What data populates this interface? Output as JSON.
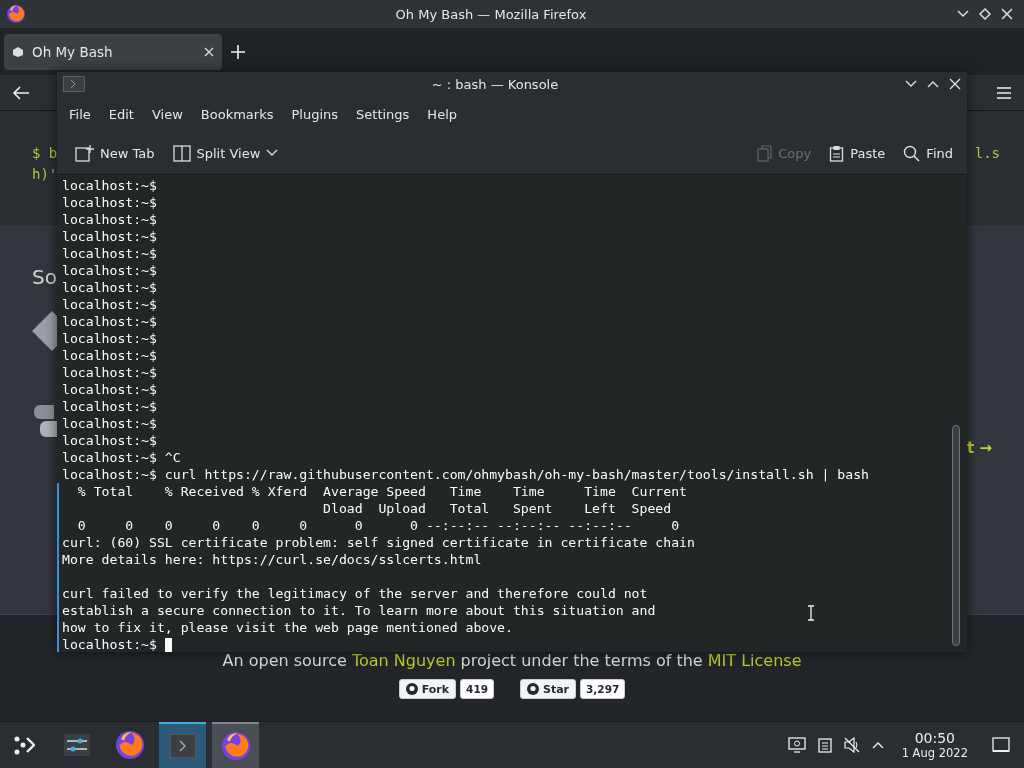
{
  "firefox_window": {
    "title": "Oh My Bash — Mozilla Firefox",
    "tabs": [
      {
        "label": "Oh My Bash",
        "selected": true
      }
    ],
    "page": {
      "code_fragments": [
        "$ b",
        "l.s",
        "h)'"
      ],
      "heading_fragment": "So",
      "link_fragment": "t →",
      "footer": [
        {
          "kind": "plain",
          "text": "An open source "
        },
        {
          "kind": "link",
          "text": "Toan Nguyen"
        },
        {
          "kind": "plain",
          "text": " project under the terms of the "
        },
        {
          "kind": "link",
          "text": "MIT License"
        }
      ],
      "badges": [
        {
          "label": "Fork",
          "count": "419"
        },
        {
          "label": "Star",
          "count": "3,297"
        }
      ]
    }
  },
  "konsole_window": {
    "title": "~ : bash — Konsole",
    "menu": [
      "File",
      "Edit",
      "View",
      "Bookmarks",
      "Plugins",
      "Settings",
      "Help"
    ],
    "toolbar": [
      {
        "kind": "new_tab",
        "label": "New Tab",
        "disabled": false
      },
      {
        "kind": "split_view",
        "label": "Split View",
        "disabled": false
      },
      {
        "kind": "copy",
        "label": "Copy",
        "disabled": true
      },
      {
        "kind": "paste",
        "label": "Paste",
        "disabled": false
      },
      {
        "kind": "find",
        "label": "Find",
        "disabled": false
      }
    ],
    "lines": [
      {
        "kind": "text",
        "text": "localhost:~$",
        "in_block": false,
        "cursor": false
      },
      {
        "kind": "text",
        "text": "localhost:~$",
        "in_block": false,
        "cursor": false
      },
      {
        "kind": "text",
        "text": "localhost:~$",
        "in_block": false,
        "cursor": false
      },
      {
        "kind": "text",
        "text": "localhost:~$",
        "in_block": false,
        "cursor": false
      },
      {
        "kind": "text",
        "text": "localhost:~$",
        "in_block": false,
        "cursor": false
      },
      {
        "kind": "text",
        "text": "localhost:~$",
        "in_block": false,
        "cursor": false
      },
      {
        "kind": "text",
        "text": "localhost:~$",
        "in_block": false,
        "cursor": false
      },
      {
        "kind": "text",
        "text": "localhost:~$",
        "in_block": false,
        "cursor": false
      },
      {
        "kind": "text",
        "text": "localhost:~$",
        "in_block": false,
        "cursor": false
      },
      {
        "kind": "text",
        "text": "localhost:~$",
        "in_block": false,
        "cursor": false
      },
      {
        "kind": "text",
        "text": "localhost:~$",
        "in_block": false,
        "cursor": false
      },
      {
        "kind": "text",
        "text": "localhost:~$",
        "in_block": false,
        "cursor": false
      },
      {
        "kind": "text",
        "text": "localhost:~$",
        "in_block": false,
        "cursor": false
      },
      {
        "kind": "text",
        "text": "localhost:~$",
        "in_block": false,
        "cursor": false
      },
      {
        "kind": "text",
        "text": "localhost:~$",
        "in_block": false,
        "cursor": false
      },
      {
        "kind": "text",
        "text": "localhost:~$",
        "in_block": false,
        "cursor": false
      },
      {
        "kind": "text",
        "text": "localhost:~$ ^C",
        "in_block": false,
        "cursor": false
      },
      {
        "kind": "text",
        "text": "localhost:~$ curl https://raw.githubusercontent.com/ohmybash/oh-my-bash/master/tools/install.sh | bash",
        "in_block": false,
        "cursor": false
      },
      {
        "kind": "text",
        "text": "  % Total    % Received % Xferd  Average Speed   Time    Time     Time  Current",
        "in_block": true,
        "cursor": false
      },
      {
        "kind": "text",
        "text": "                                 Dload  Upload   Total   Spent    Left  Speed",
        "in_block": true,
        "cursor": false
      },
      {
        "kind": "text",
        "text": "  0     0    0     0    0     0      0      0 --:--:-- --:--:-- --:--:--     0",
        "in_block": true,
        "cursor": false
      },
      {
        "kind": "text",
        "text": "curl: (60) SSL certificate problem: self signed certificate in certificate chain",
        "in_block": true,
        "cursor": false
      },
      {
        "kind": "text",
        "text": "More details here: https://curl.se/docs/sslcerts.html",
        "in_block": true,
        "cursor": false
      },
      {
        "kind": "blank",
        "in_block": true,
        "cursor": false
      },
      {
        "kind": "text",
        "text": "curl failed to verify the legitimacy of the server and therefore could not",
        "in_block": true,
        "cursor": false
      },
      {
        "kind": "text",
        "text": "establish a secure connection to it. To learn more about this situation and",
        "in_block": true,
        "cursor": false
      },
      {
        "kind": "text",
        "text": "how to fix it, please visit the web page mentioned above.",
        "in_block": true,
        "cursor": false
      },
      {
        "kind": "text",
        "text": "localhost:~$",
        "in_block": true,
        "cursor": true
      }
    ]
  },
  "taskbar": {
    "tasks": [
      {
        "kind": "launcher",
        "active": false,
        "open": false
      },
      {
        "kind": "settings",
        "active": false,
        "open": false
      },
      {
        "kind": "browser",
        "active": false,
        "open": false
      },
      {
        "kind": "terminal",
        "active": true,
        "open": true
      },
      {
        "kind": "browser",
        "active": false,
        "open": true
      }
    ],
    "clock": {
      "time": "00:50",
      "date": "1 Aug 2022"
    }
  }
}
